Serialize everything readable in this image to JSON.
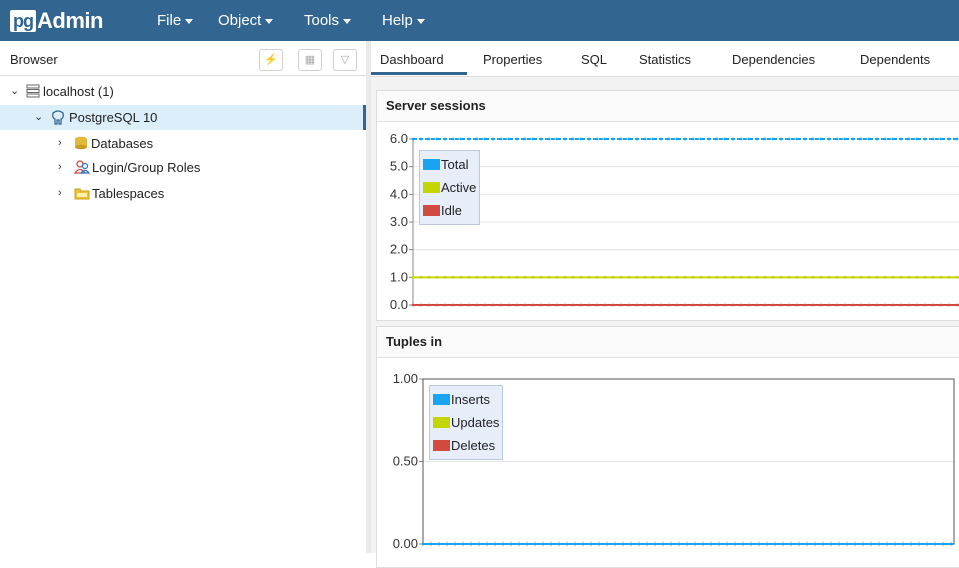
{
  "app": {
    "logo_prefix": "pg",
    "logo_suffix": "Admin",
    "menus": [
      {
        "label": "File"
      },
      {
        "label": "Object"
      },
      {
        "label": "Tools"
      },
      {
        "label": "Help"
      }
    ]
  },
  "browser": {
    "title": "Browser",
    "toolbar_icons": [
      "lightning-icon",
      "grid-icon",
      "filter-icon"
    ],
    "tree": [
      {
        "label": "localhost (1)",
        "icon": "server-group-icon",
        "expanded": true
      },
      {
        "label": "PostgreSQL 10",
        "icon": "elephant-icon",
        "expanded": true,
        "selected": true
      },
      {
        "label": "Databases",
        "icon": "databases-icon",
        "expanded": false
      },
      {
        "label": "Login/Group Roles",
        "icon": "roles-icon",
        "expanded": false
      },
      {
        "label": "Tablespaces",
        "icon": "tablespaces-icon",
        "expanded": false
      }
    ]
  },
  "tabs": [
    {
      "label": "Dashboard",
      "active": true
    },
    {
      "label": "Properties"
    },
    {
      "label": "SQL"
    },
    {
      "label": "Statistics"
    },
    {
      "label": "Dependencies"
    },
    {
      "label": "Dependents"
    }
  ],
  "colors": {
    "navbar": "#326690",
    "total": "#1aa3f0",
    "active": "#c4d600",
    "idle": "#d24a3f"
  },
  "chart_data": [
    {
      "type": "line",
      "title": "Server sessions",
      "yticks": [
        "0.0",
        "1.0",
        "2.0",
        "3.0",
        "4.0",
        "5.0",
        "6.0"
      ],
      "ylim": [
        0,
        6
      ],
      "series": [
        {
          "name": "Total",
          "value": 6,
          "color": "#1aa3f0"
        },
        {
          "name": "Active",
          "value": 1,
          "color": "#c4d600"
        },
        {
          "name": "Idle",
          "value": 0,
          "color": "#d24a3f"
        }
      ]
    },
    {
      "type": "line",
      "title": "Tuples in",
      "yticks": [
        "0.00",
        "0.50",
        "1.00"
      ],
      "ylim": [
        0,
        1
      ],
      "series": [
        {
          "name": "Inserts",
          "value": 0,
          "color": "#1aa3f0"
        },
        {
          "name": "Updates",
          "value": 0,
          "color": "#c4d600"
        },
        {
          "name": "Deletes",
          "value": 0,
          "color": "#d24a3f"
        }
      ]
    }
  ]
}
